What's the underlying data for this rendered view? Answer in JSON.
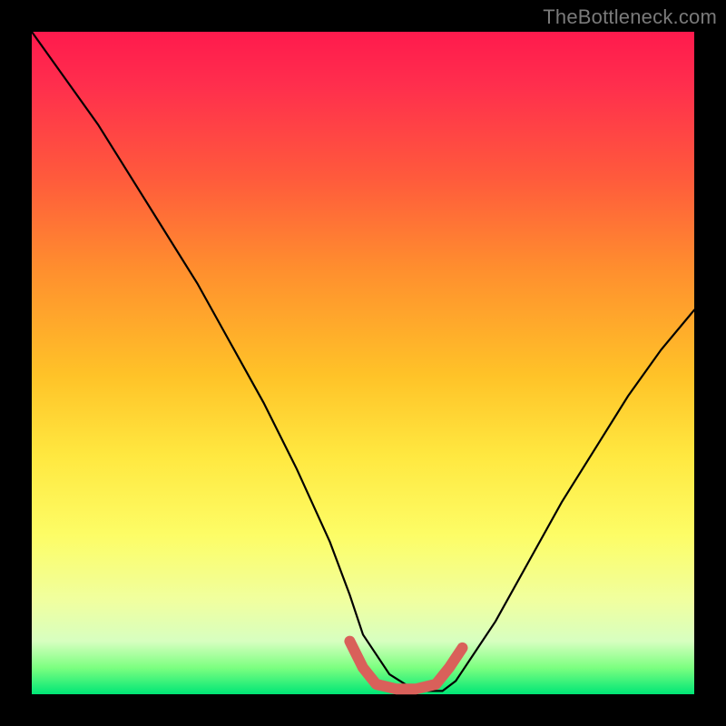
{
  "attribution": "TheBottleneck.com",
  "chart_data": {
    "type": "line",
    "title": "",
    "xlabel": "",
    "ylabel": "",
    "xlim": [
      0,
      100
    ],
    "ylim": [
      0,
      100
    ],
    "grid": false,
    "legend": false,
    "series": [
      {
        "name": "bottleneck-curve",
        "color": "#000000",
        "x": [
          0,
          5,
          10,
          15,
          20,
          25,
          30,
          35,
          40,
          45,
          48,
          50,
          54,
          58,
          62,
          64,
          66,
          70,
          75,
          80,
          85,
          90,
          95,
          100
        ],
        "y": [
          100,
          93,
          86,
          78,
          70,
          62,
          53,
          44,
          34,
          23,
          15,
          9,
          3,
          0.5,
          0.5,
          2,
          5,
          11,
          20,
          29,
          37,
          45,
          52,
          58
        ]
      },
      {
        "name": "optimal-range-marker",
        "color": "#d9605a",
        "x": [
          48,
          50,
          52,
          55,
          58,
          61,
          63,
          65
        ],
        "y": [
          8,
          4,
          1.5,
          0.8,
          0.8,
          1.5,
          4,
          7
        ]
      }
    ]
  }
}
